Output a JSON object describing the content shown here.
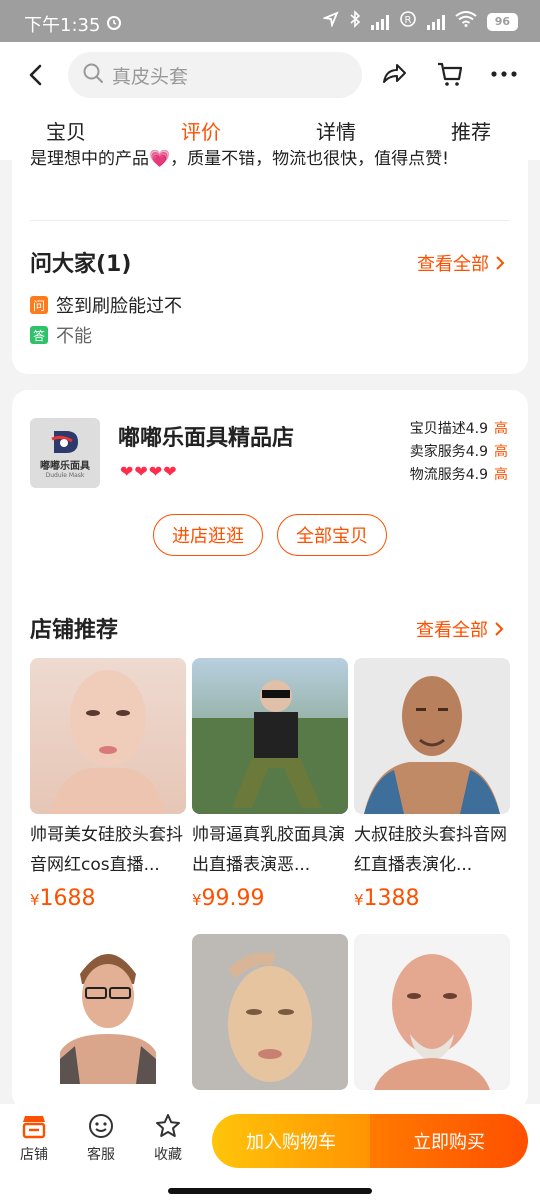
{
  "status": {
    "time": "下午1:35",
    "battery": "96"
  },
  "header": {
    "search_placeholder": "真皮头套"
  },
  "tabs": [
    {
      "label": "宝贝"
    },
    {
      "label": "评价"
    },
    {
      "label": "详情"
    },
    {
      "label": "推荐"
    }
  ],
  "review": {
    "snippet": "是理想中的产品💗，质量不错，物流也很快，值得点赞!"
  },
  "qa": {
    "title": "问大家(1)",
    "view_all": "查看全部",
    "q_badge": "问",
    "question": "签到刷脸能过不",
    "a_badge": "答",
    "answer": "不能"
  },
  "shop": {
    "name": "嘟嘟乐面具精品店",
    "logo_text": "嘟嘟乐面具",
    "logo_subtext": "Dudule Mask",
    "hearts": "❤❤❤❤",
    "scores": [
      {
        "label": "宝贝描述",
        "value": "4.9",
        "grade": "高"
      },
      {
        "label": "卖家服务",
        "value": "4.9",
        "grade": "高"
      },
      {
        "label": "物流服务",
        "value": "4.9",
        "grade": "高"
      }
    ],
    "enter_button": "进店逛逛",
    "all_items_button": "全部宝贝"
  },
  "recommend": {
    "title": "店铺推荐",
    "view_all": "查看全部",
    "products": [
      {
        "name": "帅哥美女硅胶头套抖音网红cos直播...",
        "currency": "¥",
        "price": "1688"
      },
      {
        "name": "帅哥逼真乳胶面具演出直播表演恶...",
        "currency": "¥",
        "price": "99.99"
      },
      {
        "name": "大叔硅胶头套抖音网红直播表演化...",
        "currency": "¥",
        "price": "1388"
      },
      {
        "name": "",
        "currency": "",
        "price": ""
      },
      {
        "name": "",
        "currency": "",
        "price": ""
      },
      {
        "name": "",
        "currency": "",
        "price": ""
      }
    ]
  },
  "bottom": {
    "store": "店铺",
    "service": "客服",
    "favorite": "收藏",
    "add_to_cart": "加入购物车",
    "buy_now": "立即购买"
  },
  "colors": {
    "accent": "#ff5000",
    "cart_yellow": "#ffb000"
  }
}
